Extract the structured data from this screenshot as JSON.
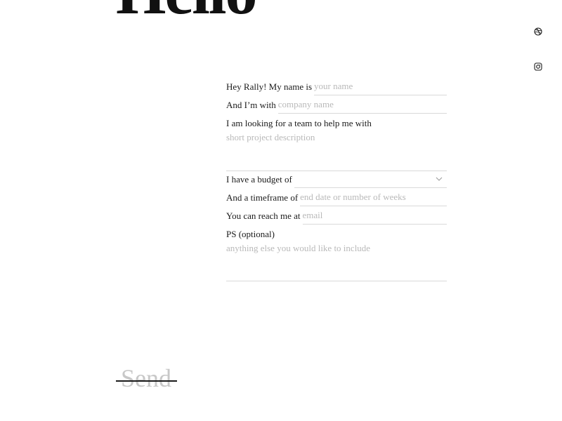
{
  "hero": {
    "title": "Hello"
  },
  "social": [
    {
      "icon": "dribbble-icon"
    },
    {
      "icon": "instagram-icon"
    }
  ],
  "form": {
    "name_label": "Hey Rally! My name is",
    "name_placeholder": "your name",
    "company_label": "And I’m with",
    "company_placeholder": "company name",
    "project_label": "I am looking for a team to help me with",
    "project_placeholder": "short project description",
    "budget_label": "I have a budget of",
    "budget_value": "",
    "timeframe_label": "And a timeframe of",
    "timeframe_placeholder": "end date or number of weeks",
    "email_label": "You can reach me at",
    "email_placeholder": "email",
    "ps_label": "PS (optional)",
    "ps_placeholder": "anything else you would like to include"
  },
  "send": {
    "label": "Send"
  },
  "colors": {
    "text": "#1a1a1a",
    "placeholder": "#b9b9b9",
    "rule": "#d9d9d9",
    "send_text": "#c8c8c8"
  }
}
